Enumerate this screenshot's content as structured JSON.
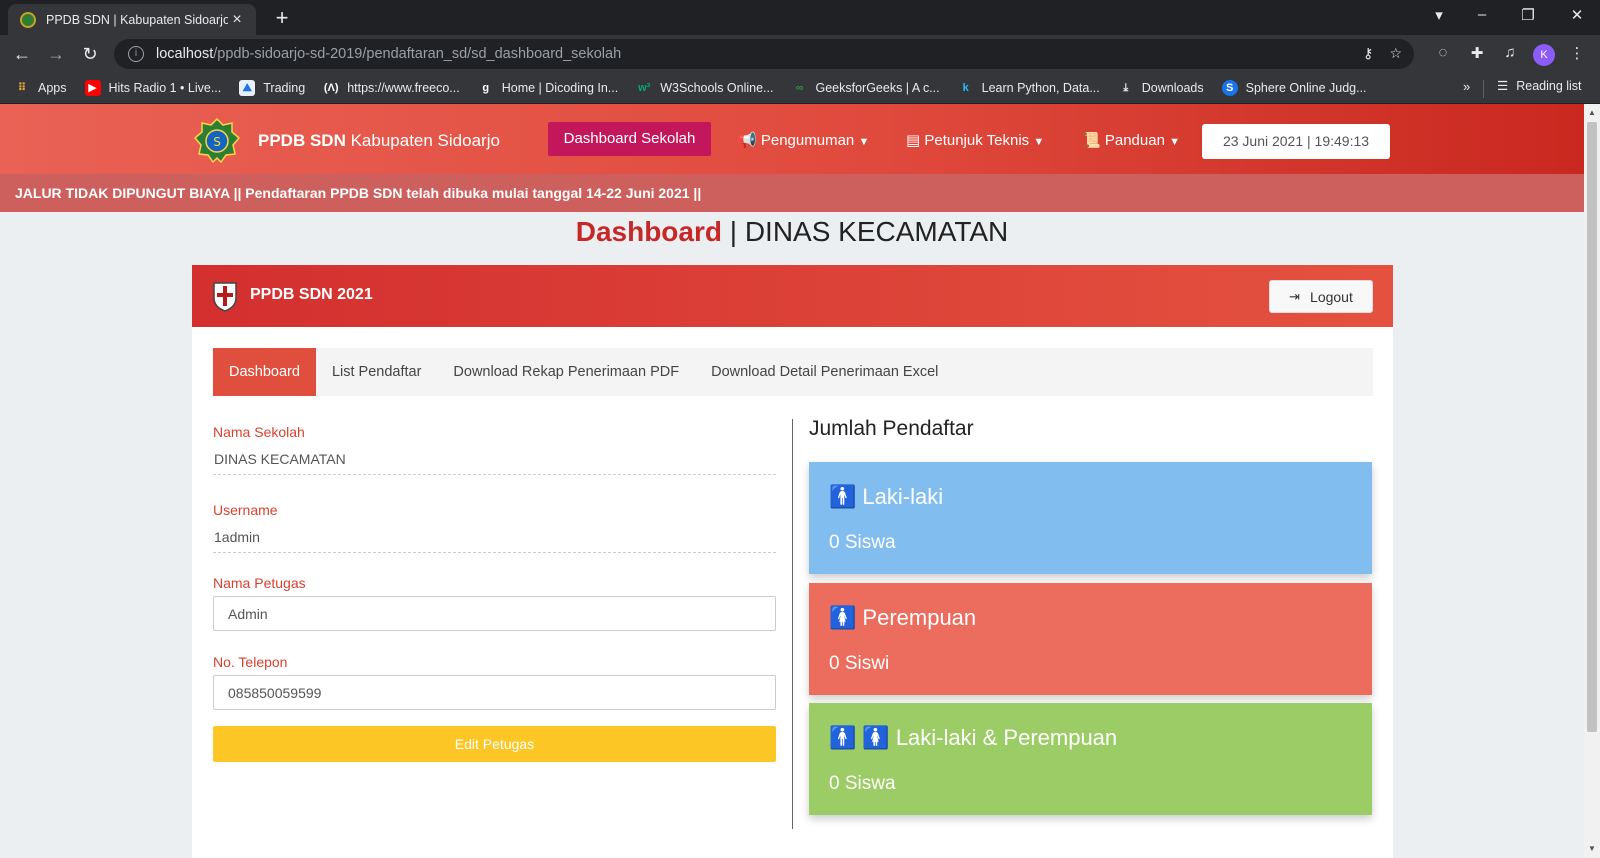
{
  "browser": {
    "tab_title": "PPDB SDN | Kabupaten Sidoarjo",
    "url_host": "localhost",
    "url_path": "/ppdb-sidoarjo-sd-2019/pendaftaran_sd/sd_dashboard_sekolah",
    "profile_initial": "K",
    "bookmarks": [
      {
        "label": "Apps",
        "icon": "apps-grid-icon"
      },
      {
        "label": "Hits Radio 1 • Live...",
        "icon": "youtube-icon"
      },
      {
        "label": "Trading",
        "icon": "trading-icon"
      },
      {
        "label": "https://www.freeco...",
        "icon": "freecodecamp-icon"
      },
      {
        "label": "Home | Dicoding In...",
        "icon": "dicoding-icon"
      },
      {
        "label": "W3Schools Online...",
        "icon": "w3schools-icon"
      },
      {
        "label": "GeeksforGeeks | A c...",
        "icon": "geeksforgeeks-icon"
      },
      {
        "label": "Learn Python, Data...",
        "icon": "kaggle-icon"
      },
      {
        "label": "Downloads",
        "icon": "download-icon"
      },
      {
        "label": "Sphere Online Judg...",
        "icon": "spoj-icon"
      }
    ],
    "more_bookmarks": "»",
    "reading_list": "Reading list"
  },
  "header": {
    "brand_bold": "PPDB SDN",
    "brand_rest": "Kabupaten Sidoarjo",
    "menu": {
      "dashboard": "Dashboard Sekolah",
      "pengumuman": "Pengumuman",
      "petunjuk": "Petunjuk Teknis",
      "panduan": "Panduan"
    },
    "datetime": "23 Juni 2021 | 19:49:13"
  },
  "ticker": "JALUR TIDAK DIPUNGUT BIAYA || Pendaftaran PPDB SDN telah dibuka mulai tanggal 14-22 Juni 2021 ||",
  "page_title": {
    "highlight": "Dashboard",
    "rest": " | DINAS KECAMATAN"
  },
  "card": {
    "title": "PPDB SDN 2021",
    "logout": "Logout",
    "tabs": [
      "Dashboard",
      "List Pendaftar",
      "Download Rekap Penerimaan PDF",
      "Download Detail Penerimaan Excel"
    ]
  },
  "form": {
    "nama_sekolah_label": "Nama Sekolah",
    "nama_sekolah_value": "DINAS KECAMATAN",
    "username_label": "Username",
    "username_value": "1admin",
    "nama_petugas_label": "Nama Petugas",
    "nama_petugas_value": "Admin",
    "telepon_label": "No. Telepon",
    "telepon_value": "085850059599",
    "edit_button": "Edit Petugas"
  },
  "stats": {
    "title": "Jumlah Pendaftar",
    "items": [
      {
        "label": "Laki-laki",
        "count": "0 Siswa",
        "color": "#82bdf0"
      },
      {
        "label": "Perempuan",
        "count": "0 Siswi",
        "color": "#ec6c5d"
      },
      {
        "label": "Laki-laki & Perempuan",
        "count": "0 Siswa",
        "color": "#9ccc65"
      }
    ]
  },
  "colors": {
    "header_start": "#e96255",
    "header_end": "#c9281f",
    "active_menu": "#c2185b",
    "accent_red": "#d9412f",
    "edit_button": "#fcc624"
  }
}
